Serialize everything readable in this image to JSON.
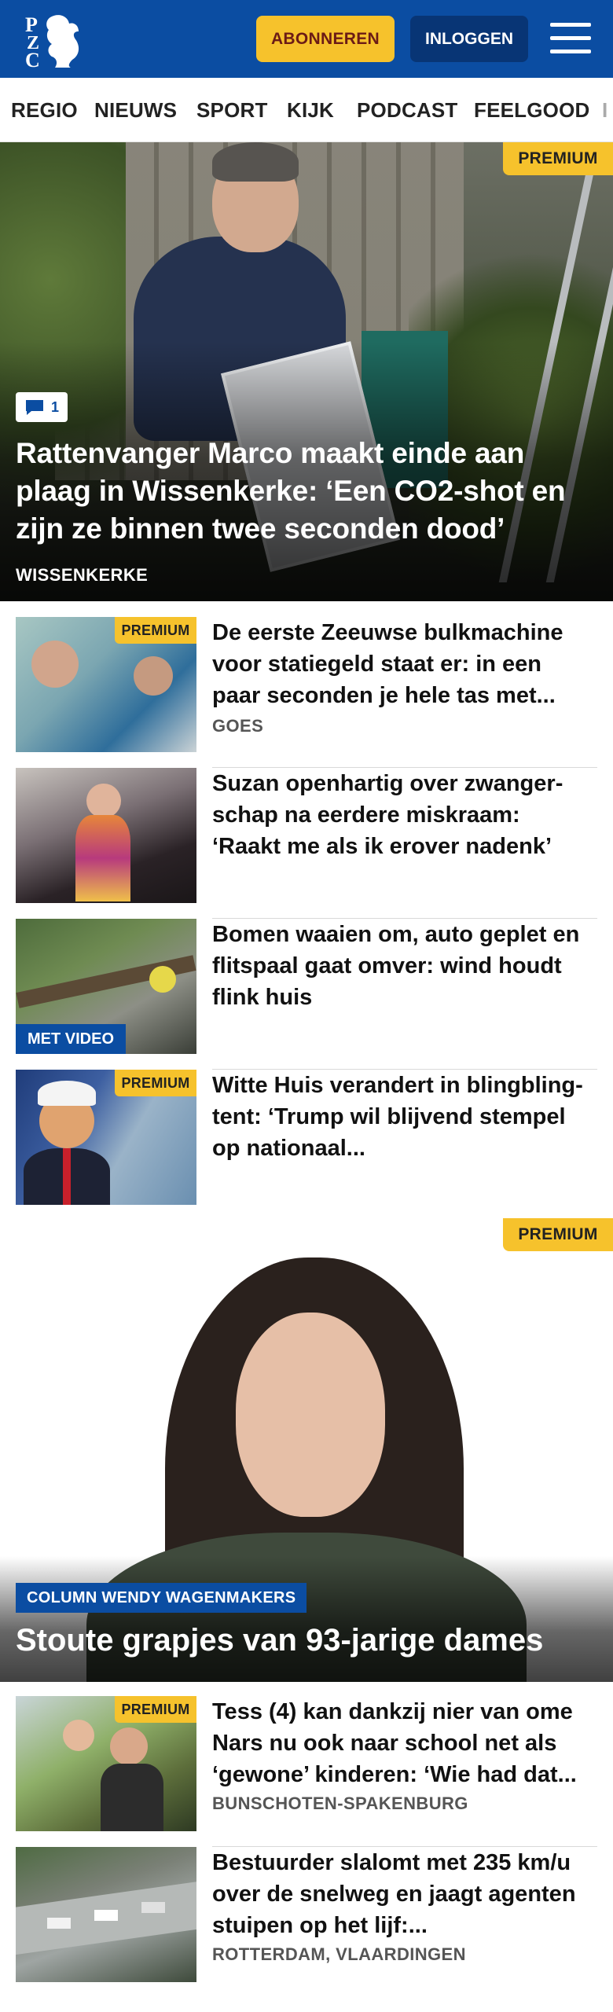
{
  "header": {
    "logo_letters": "PZC",
    "subscribe_label": "ABONNEREN",
    "login_label": "INLOGGEN",
    "menu_icon": "hamburger-menu-icon",
    "brand_color": "#0b4da2",
    "accent_color": "#f6c22c"
  },
  "nav": {
    "items": [
      "REGIO",
      "NIEUWS",
      "SPORT",
      "KIJK",
      "PODCAST",
      "FEELGOOD",
      "I"
    ]
  },
  "hero": {
    "premium_label": "PREMIUM",
    "comment_count": "1",
    "title": "Rattenvanger Marco maakt einde aan plaag in Wissenkerke: ‘Een CO2-shot en zijn ze binnen twee seconden dood’",
    "location": "WISSENKERKE"
  },
  "articles": [
    {
      "premium_label": "PREMIUM",
      "title": "De eerste Zeeuwse bulkmachine voor statiegeld staat er: in een paar seconden je hele tas met...",
      "location": "GOES"
    },
    {
      "title": "Suzan openhartig over zwanger­schap na eerdere miskraam: ‘Raakt me als ik erover nadenk’"
    },
    {
      "video_label": "MET VIDEO",
      "title": "Bomen waaien om, auto geplet en flitspaal gaat omver: wind houdt flink huis"
    },
    {
      "premium_label": "PREMIUM",
      "title": "Witte Huis verandert in blingbling-tent: ‘Trump wil blijvend stempel op nationaal..."
    }
  ],
  "column": {
    "premium_label": "PREMIUM",
    "tag": "COLUMN WENDY WAGENMAKERS",
    "title": "Stoute grapjes van 93-jarige dames"
  },
  "articles2": [
    {
      "premium_label": "PREMIUM",
      "title": "Tess (4) kan dankzij nier van ome Nars nu ook naar school net als ‘gewone’ kinderen: ‘Wie had dat...",
      "location": "BUNSCHOTEN-SPAKENBURG"
    },
    {
      "title": "Bestuurder slalomt met 235 km/u over de snelweg en jaagt agenten stuipen op het lijf:...",
      "location": "ROTTERDAM, VLAARDINGEN"
    }
  ]
}
